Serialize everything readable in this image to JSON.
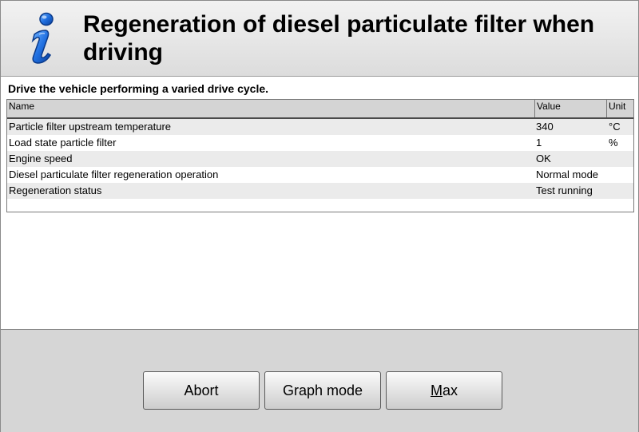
{
  "header": {
    "title": "Regeneration of diesel particulate filter when driving",
    "icon": "info-icon",
    "icon_color": "#1a5fc4"
  },
  "main": {
    "instruction": "Drive the vehicle performing a varied drive cycle.",
    "table": {
      "columns": [
        "Name",
        "Value",
        "Unit"
      ],
      "rows": [
        {
          "name": "Particle filter upstream temperature",
          "value": "340",
          "unit": "°C"
        },
        {
          "name": "Load state particle filter",
          "value": "1",
          "unit": "%"
        },
        {
          "name": "Engine speed",
          "value": "OK",
          "unit": ""
        },
        {
          "name": "Diesel particulate filter regeneration operation",
          "value": "Normal mode",
          "unit": ""
        },
        {
          "name": "Regeneration status",
          "value": "Test running",
          "unit": ""
        }
      ]
    }
  },
  "footer": {
    "abort_label": "Abort",
    "graph_mode_label": "Graph mode",
    "max_label_mnemonic": "M",
    "max_label_rest": "ax"
  }
}
